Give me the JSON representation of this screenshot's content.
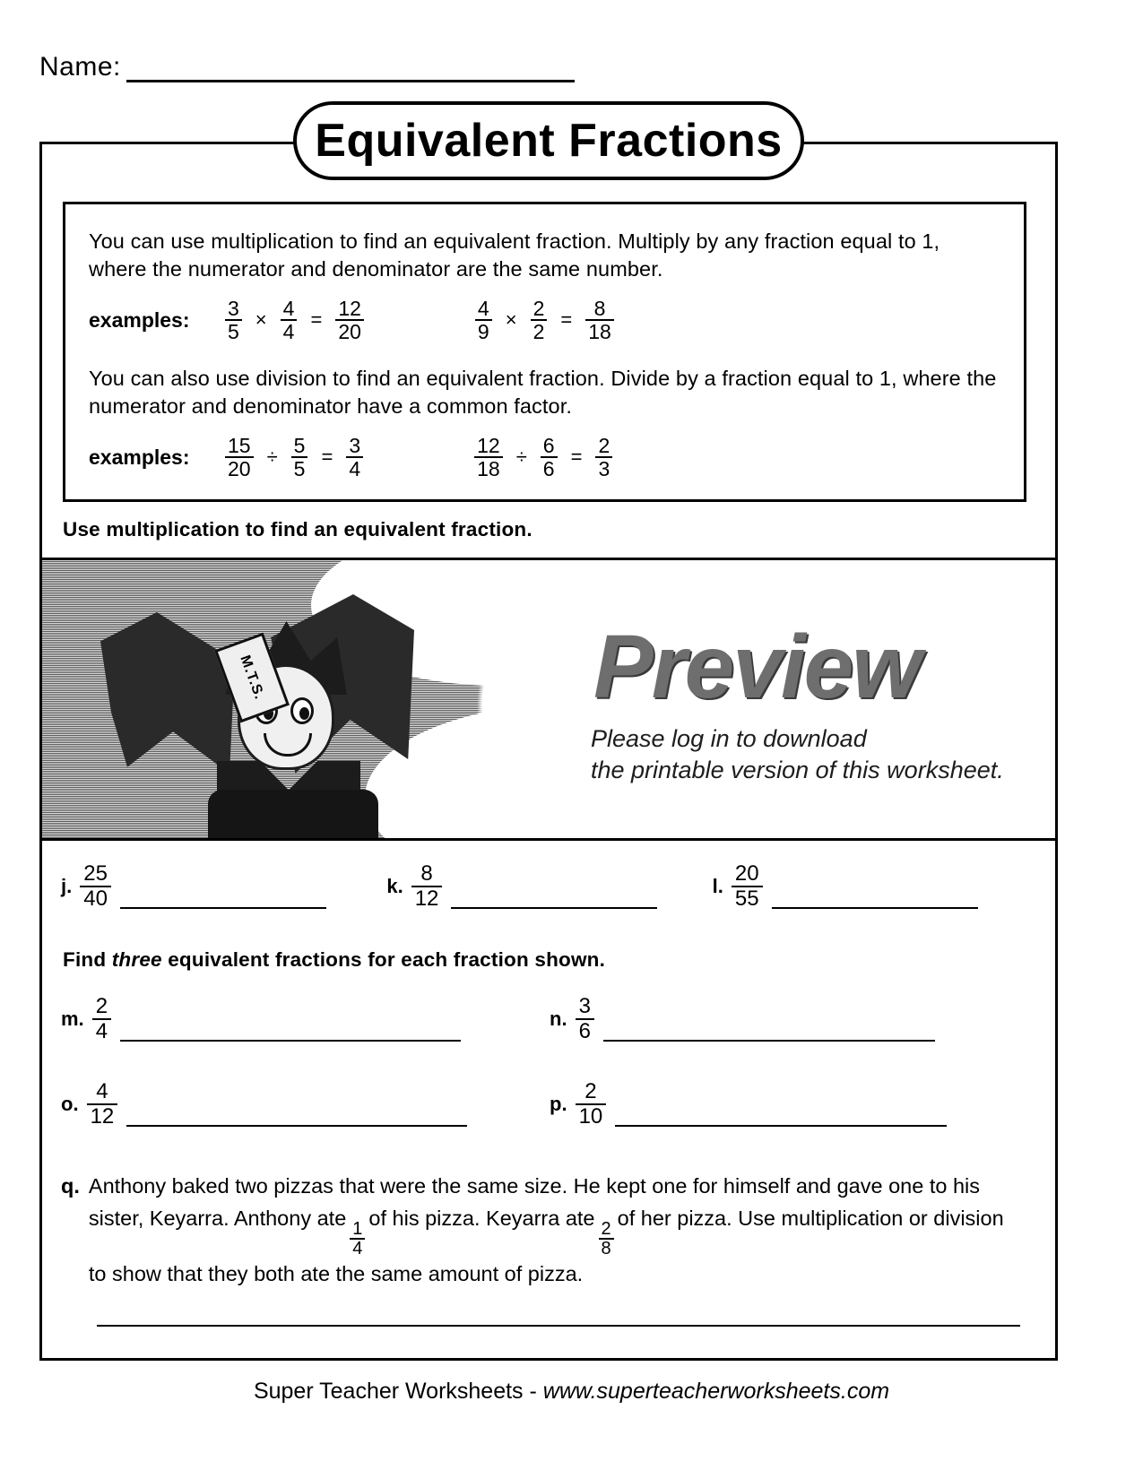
{
  "header": {
    "name_label": "Name:",
    "title": "Equivalent Fractions"
  },
  "info_box": {
    "paragraph1": "You can use multiplication to find an equivalent fraction. Multiply by any fraction equal to 1, where the numerator and denominator are the same number.",
    "examples_label_1": "examples:",
    "paragraph2": "You can also use division to find an equivalent fraction.  Divide by a fraction equal to 1, where the numerator and denominator have a common factor.",
    "examples_label_2": "examples:",
    "multiply_examples": [
      {
        "a_num": "3",
        "a_den": "5",
        "op": "×",
        "b_num": "4",
        "b_den": "4",
        "eq": "=",
        "c_num": "12",
        "c_den": "20"
      },
      {
        "a_num": "4",
        "a_den": "9",
        "op": "×",
        "b_num": "2",
        "b_den": "2",
        "eq": "=",
        "c_num": "8",
        "c_den": "18"
      }
    ],
    "divide_examples": [
      {
        "a_num": "15",
        "a_den": "20",
        "op": "÷",
        "b_num": "5",
        "b_den": "5",
        "eq": "=",
        "c_num": "3",
        "c_den": "4"
      },
      {
        "a_num": "12",
        "a_den": "18",
        "op": "÷",
        "b_num": "6",
        "b_den": "6",
        "eq": "=",
        "c_num": "2",
        "c_den": "3"
      }
    ]
  },
  "instructions": {
    "multiplication": "Use multiplication to find an equivalent fraction.",
    "find_three_pre": "Find ",
    "find_three_ital": "three",
    "find_three_post": " equivalent fractions for each fraction shown."
  },
  "preview_banner": {
    "word": "Preview",
    "sub_line1": "Please log in to download",
    "sub_line2": "the printable version of this worksheet.",
    "mascot_badge": "M.T.S."
  },
  "problems_jkl": [
    {
      "letter": "j.",
      "num": "25",
      "den": "40"
    },
    {
      "letter": "k.",
      "num": "8",
      "den": "12"
    },
    {
      "letter": "l.",
      "num": "20",
      "den": "55"
    }
  ],
  "problems_mn": [
    {
      "letter": "m.",
      "num": "2",
      "den": "4"
    },
    {
      "letter": "n.",
      "num": "3",
      "den": "6"
    }
  ],
  "problems_op": [
    {
      "letter": "o.",
      "num": "4",
      "den": "12"
    },
    {
      "letter": "p.",
      "num": "2",
      "den": "10"
    }
  ],
  "word_problem": {
    "letter": "q.",
    "text_part1": "Anthony baked two pizzas that were the same size. He kept one for himself and gave one to his sister, Keyarra. Anthony ate",
    "frac1_num": "1",
    "frac1_den": "4",
    "text_part2": "of his pizza. Keyarra ate",
    "frac2_num": "2",
    "frac2_den": "8",
    "text_part3": "of her pizza. Use multiplication or division to show that they both ate the same amount of pizza."
  },
  "footer": {
    "credit": "Super Teacher Worksheets - ",
    "url": "www.superteacherworksheets.com"
  }
}
